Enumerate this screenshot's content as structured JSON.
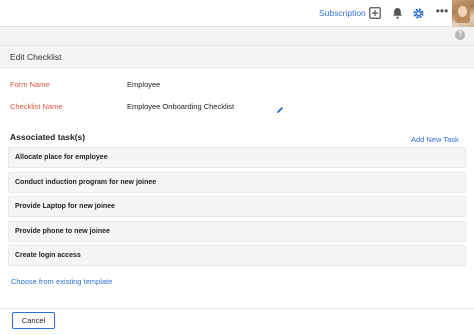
{
  "topbar": {
    "subscription_label": "Subscription",
    "icons": [
      "plus-box-icon",
      "bell-icon",
      "gear-icon",
      "more-icon",
      "avatar"
    ],
    "accent_color": "#2f6fd1",
    "more_glyph": "•••"
  },
  "help": {
    "glyph": "?"
  },
  "panel": {
    "title": "Edit Checklist",
    "form_name_label": "Form Name",
    "form_name_value": "Employee",
    "checklist_name_label": "Checklist Name",
    "checklist_name_value": "Employee Onboarding Checklist",
    "associated_tasks_title": "Associated task(s)",
    "add_new_task_label": "Add New Task",
    "tasks": [
      "Allocate place for employee",
      "Conduct induction program for new joinee",
      "Provide Laptop for new joinee",
      "Provide phone to new joinee",
      "Create login access"
    ],
    "choose_template_label": "Choose from existing template",
    "cancel_label": "Cancel",
    "label_color": "#e0573c"
  }
}
